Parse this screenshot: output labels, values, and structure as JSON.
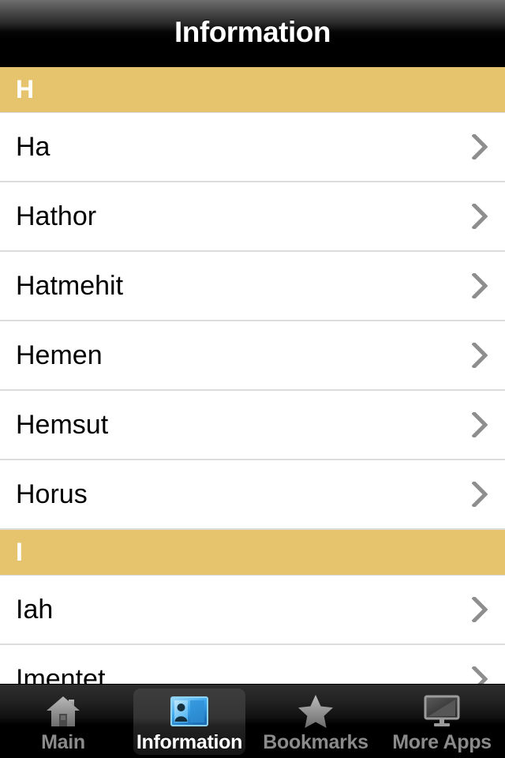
{
  "navbar": {
    "title": "Information"
  },
  "list": {
    "sections": [
      {
        "letter": "H",
        "rows": [
          {
            "label": "Ha"
          },
          {
            "label": "Hathor"
          },
          {
            "label": "Hatmehit"
          },
          {
            "label": "Hemen"
          },
          {
            "label": "Hemsut"
          },
          {
            "label": "Horus"
          }
        ]
      },
      {
        "letter": "I",
        "rows": [
          {
            "label": "Iah"
          },
          {
            "label": "Imentet"
          }
        ]
      }
    ],
    "disclosure_icon": "chevron-right-icon"
  },
  "tabbar": {
    "tabs": [
      {
        "label": "Main",
        "icon": "house-icon",
        "selected": false
      },
      {
        "label": "Information",
        "icon": "contact-card-icon",
        "selected": true
      },
      {
        "label": "Bookmarks",
        "icon": "star-icon",
        "selected": false
      },
      {
        "label": "More Apps",
        "icon": "monitor-icon",
        "selected": false
      }
    ]
  },
  "colors": {
    "section_header_bg": "#e6c46e",
    "section_header_text": "#ffffff",
    "row_bg": "#ffffff",
    "row_text": "#000000",
    "separator": "#dcdcdc",
    "chevron": "#8e8e8e",
    "navbar_text": "#ffffff",
    "tab_selected_text": "#ffffff",
    "tab_text": "#8b8b8b",
    "tab_icon_accent": "#37a6f0"
  }
}
